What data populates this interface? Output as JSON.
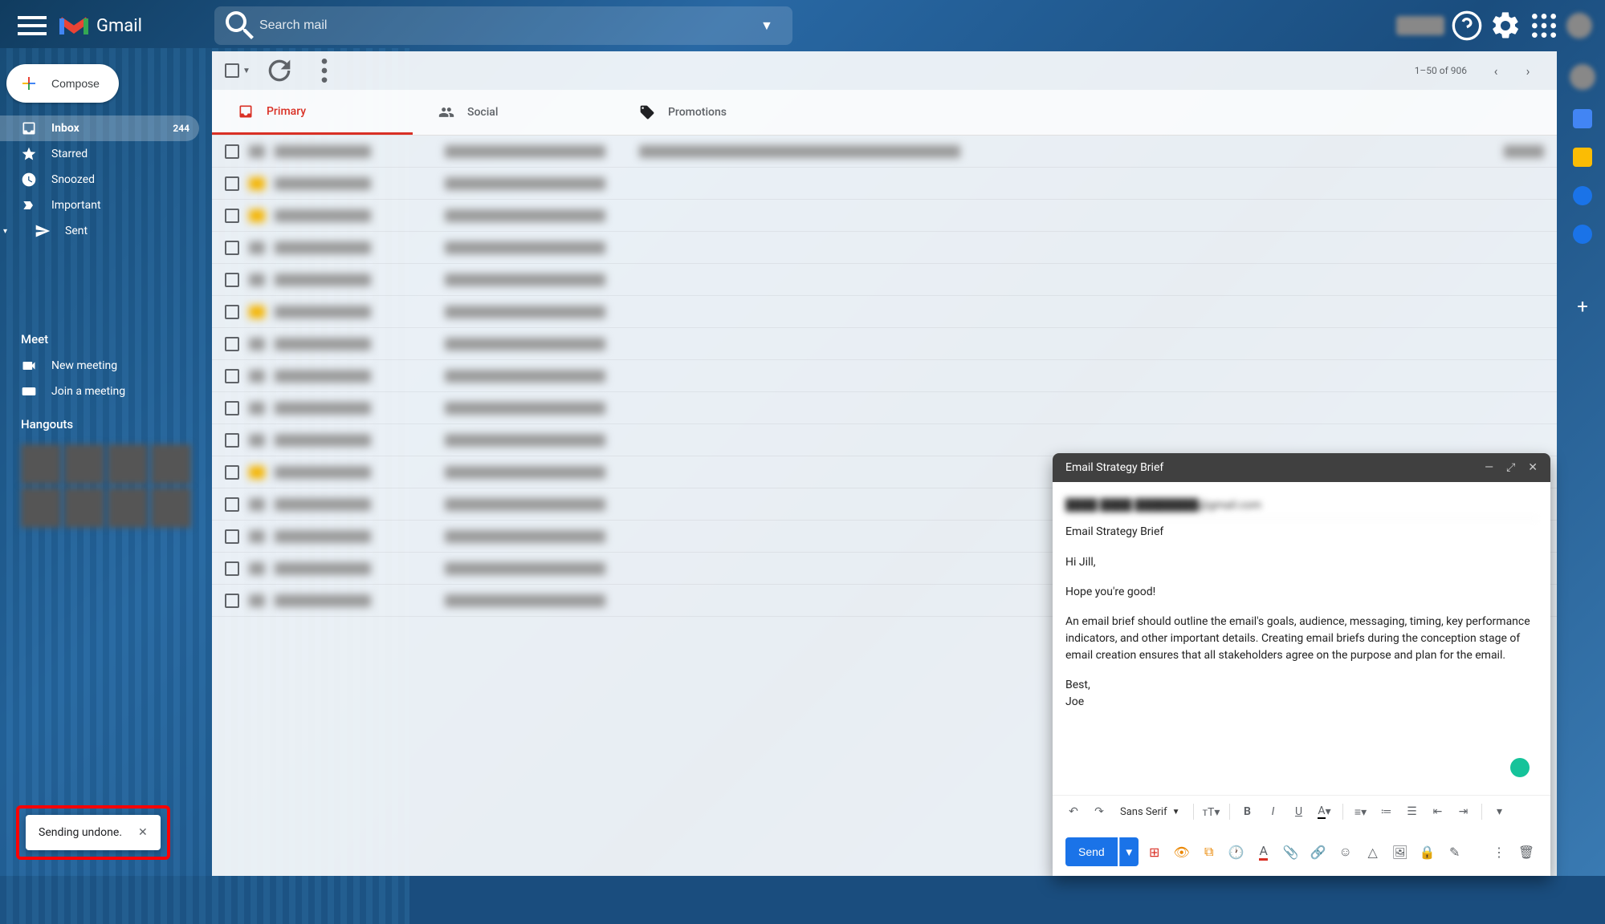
{
  "app": {
    "logo_text": "Gmail"
  },
  "search": {
    "placeholder": "Search mail"
  },
  "compose_button": "Compose",
  "sidebar": {
    "items": [
      {
        "label": "Inbox",
        "count": "244"
      },
      {
        "label": "Starred"
      },
      {
        "label": "Snoozed"
      },
      {
        "label": "Important"
      },
      {
        "label": "Sent"
      }
    ]
  },
  "meet": {
    "title": "Meet",
    "new_meeting": "New meeting",
    "join_meeting": "Join a meeting"
  },
  "hangouts": {
    "title": "Hangouts"
  },
  "pagination": "1–50 of 906",
  "tabs": {
    "primary": "Primary",
    "social": "Social",
    "promotions": "Promotions"
  },
  "compose": {
    "title": "Email Strategy Brief",
    "subject": "Email Strategy Brief",
    "body_greeting": "Hi Jill,",
    "body_line1": "Hope you're good!",
    "body_para": "An email brief should outline the email's goals, audience, messaging, timing, key performance indicators, and other important details. Creating email briefs during the conception stage of email creation ensures that all stakeholders agree on the purpose and plan for the email.",
    "body_signoff": "Best,",
    "body_name": "Joe",
    "font": "Sans Serif",
    "send": "Send"
  },
  "toast": {
    "message": "Sending undone."
  }
}
